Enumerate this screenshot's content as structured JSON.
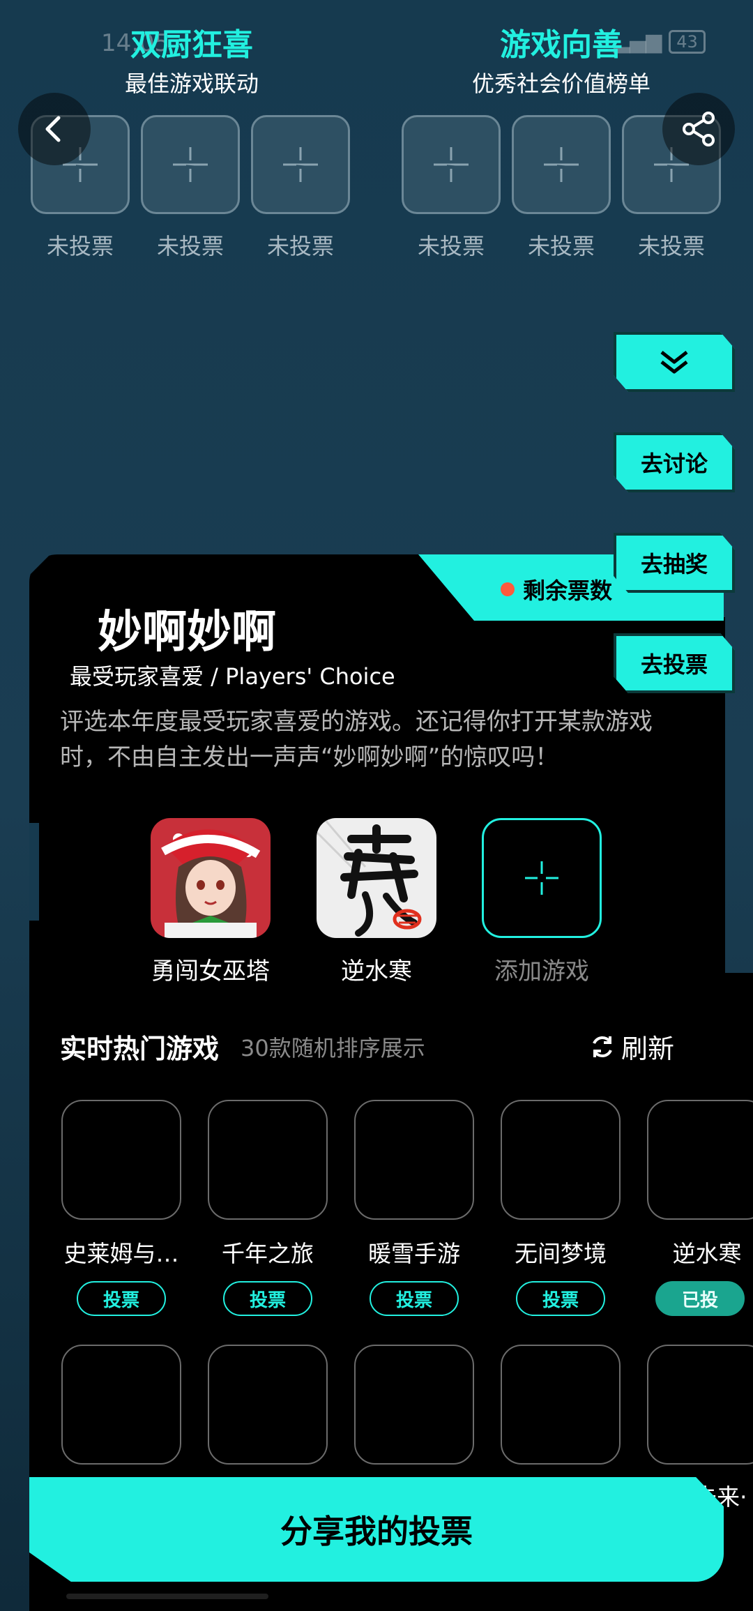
{
  "status": {
    "time": "14:05",
    "battery": "43"
  },
  "categories": [
    {
      "title": "双厨狂喜",
      "subtitle": "最佳游戏联动",
      "slots": [
        "未投票",
        "未投票",
        "未投票"
      ]
    },
    {
      "title": "游戏向善",
      "subtitle": "优秀社会价值榜单",
      "slots": [
        "未投票",
        "未投票",
        "未投票"
      ]
    }
  ],
  "side_buttons": {
    "discuss": "去讨论",
    "lottery": "去抽奖",
    "vote": "去投票"
  },
  "card": {
    "ticket_label": "剩余票数",
    "title": "妙啊妙啊",
    "subtitle": "最受玩家喜爱 / Players' Choice",
    "description": "评选本年度最受玩家喜爱的游戏。还记得你打开某款游戏时，不由自主发出一声声“妙啊妙啊”的惊叹吗！",
    "picks": [
      {
        "name": "勇闯女巫塔",
        "icon": "anime-girl-santa-icon"
      },
      {
        "name": "逆水寒",
        "icon": "calligraphy-han-icon"
      },
      {
        "name": "添加游戏",
        "icon": "plus-icon"
      }
    ]
  },
  "hot": {
    "title": "实时热门游戏",
    "subtitle": "30款随机排序展示",
    "refresh": "刷新",
    "row1": [
      {
        "name": "史莱姆与…",
        "vote": "投票"
      },
      {
        "name": "千年之旅",
        "vote": "投票"
      },
      {
        "name": "暖雪手游",
        "vote": "投票"
      },
      {
        "name": "无间梦境",
        "vote": "投票"
      },
      {
        "name": "逆水寒",
        "vote": "已投"
      }
    ],
    "row2_partial_name": "未来·"
  },
  "share_button": "分享我的投票",
  "colors": {
    "accent": "#22f0e0",
    "voted": "#1aa58f",
    "background": "#163a4f"
  }
}
